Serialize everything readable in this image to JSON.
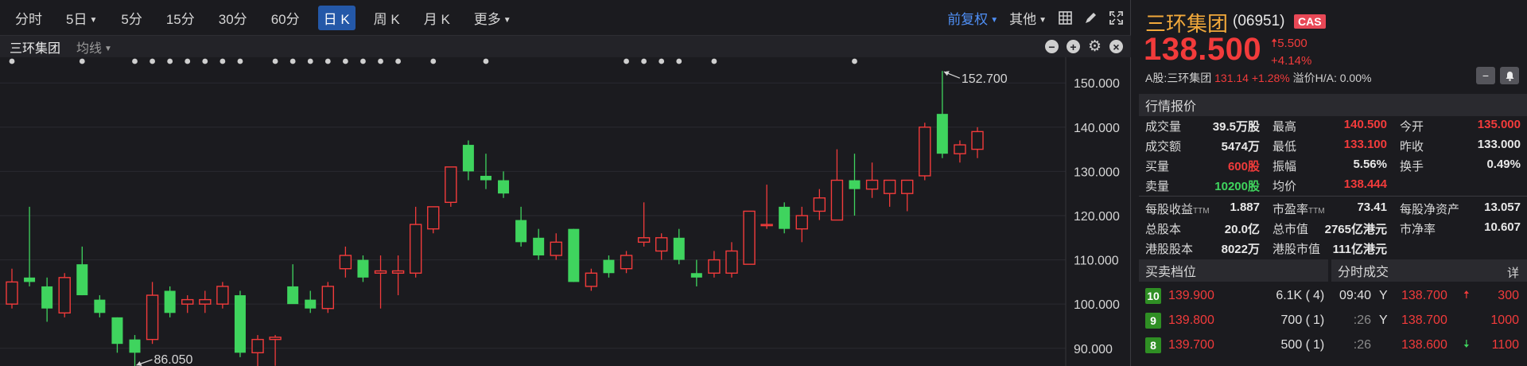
{
  "toolbar": {
    "periods": [
      "分时",
      "5日",
      "5分",
      "15分",
      "30分",
      "60分",
      "日 K",
      "周 K",
      "月 K",
      "更多"
    ],
    "fuquan": "前复权",
    "other": "其他"
  },
  "subbar": {
    "name": "三环集团",
    "ma": "均线"
  },
  "chart_data": {
    "type": "candlestick",
    "yticks": [
      "150.000",
      "140.000",
      "130.000",
      "120.000",
      "110.000",
      "100.000",
      "90.000"
    ],
    "high_label": "152.700",
    "low_label": "86.050",
    "up_color": "#f23b3b",
    "down_color": "#3fd45e",
    "markers_x_index": [
      0,
      4,
      7,
      8,
      9,
      10,
      11,
      12,
      13,
      15,
      16,
      17,
      18,
      19,
      20,
      21,
      22,
      24,
      27,
      35,
      36,
      37,
      38,
      40,
      48
    ],
    "candles": [
      {
        "o": 100,
        "h": 108,
        "l": 99,
        "c": 105
      },
      {
        "o": 106,
        "h": 122,
        "l": 104,
        "c": 105
      },
      {
        "o": 104,
        "h": 106,
        "l": 96,
        "c": 99
      },
      {
        "o": 98,
        "h": 107,
        "l": 97,
        "c": 106
      },
      {
        "o": 109,
        "h": 113,
        "l": 102,
        "c": 102
      },
      {
        "o": 101,
        "h": 102,
        "l": 97,
        "c": 98
      },
      {
        "o": 97,
        "h": 97,
        "l": 89,
        "c": 91
      },
      {
        "o": 92,
        "h": 93,
        "l": 86,
        "c": 89
      },
      {
        "o": 92,
        "h": 105,
        "l": 91,
        "c": 102
      },
      {
        "o": 103,
        "h": 104,
        "l": 97,
        "c": 98
      },
      {
        "o": 100,
        "h": 102,
        "l": 98,
        "c": 101
      },
      {
        "o": 100,
        "h": 103,
        "l": 98,
        "c": 101
      },
      {
        "o": 100,
        "h": 105,
        "l": 99,
        "c": 104
      },
      {
        "o": 102,
        "h": 103,
        "l": 88,
        "c": 89
      },
      {
        "o": 89,
        "h": 93,
        "l": 86,
        "c": 92
      },
      {
        "o": 92,
        "h": 93,
        "l": 86.05,
        "c": 92.5
      },
      {
        "o": 104,
        "h": 109,
        "l": 101,
        "c": 100
      },
      {
        "o": 101,
        "h": 103,
        "l": 98,
        "c": 99
      },
      {
        "o": 99,
        "h": 105,
        "l": 98,
        "c": 104
      },
      {
        "o": 108,
        "h": 113,
        "l": 106,
        "c": 111
      },
      {
        "o": 110,
        "h": 111,
        "l": 105,
        "c": 106
      },
      {
        "o": 107,
        "h": 111,
        "l": 99,
        "c": 107.5
      },
      {
        "o": 107,
        "h": 111,
        "l": 102,
        "c": 107.5
      },
      {
        "o": 107,
        "h": 122,
        "l": 106,
        "c": 118
      },
      {
        "o": 117,
        "h": 121,
        "l": 116,
        "c": 122
      },
      {
        "o": 123,
        "h": 128,
        "l": 122,
        "c": 131
      },
      {
        "o": 136,
        "h": 137,
        "l": 128,
        "c": 130
      },
      {
        "o": 129,
        "h": 134,
        "l": 126,
        "c": 128
      },
      {
        "o": 128,
        "h": 130,
        "l": 124,
        "c": 125
      },
      {
        "o": 119,
        "h": 122,
        "l": 113,
        "c": 114
      },
      {
        "o": 115,
        "h": 117,
        "l": 110,
        "c": 111
      },
      {
        "o": 111,
        "h": 116,
        "l": 110,
        "c": 114
      },
      {
        "o": 117,
        "h": 117,
        "l": 105,
        "c": 105
      },
      {
        "o": 104,
        "h": 108,
        "l": 103,
        "c": 107
      },
      {
        "o": 110,
        "h": 111,
        "l": 106,
        "c": 107
      },
      {
        "o": 108,
        "h": 112,
        "l": 107,
        "c": 111
      },
      {
        "o": 114,
        "h": 123,
        "l": 113,
        "c": 115
      },
      {
        "o": 112,
        "h": 116,
        "l": 110,
        "c": 115
      },
      {
        "o": 115,
        "h": 117,
        "l": 109,
        "c": 110
      },
      {
        "o": 107,
        "h": 110,
        "l": 104,
        "c": 106
      },
      {
        "o": 107,
        "h": 112,
        "l": 106,
        "c": 110
      },
      {
        "o": 107,
        "h": 114,
        "l": 106,
        "c": 112
      },
      {
        "o": 109,
        "h": 121,
        "l": 109,
        "c": 121
      },
      {
        "o": 118,
        "h": 127,
        "l": 117,
        "c": 118
      },
      {
        "o": 122,
        "h": 123,
        "l": 116,
        "c": 117
      },
      {
        "o": 117,
        "h": 122,
        "l": 114,
        "c": 120
      },
      {
        "o": 121,
        "h": 126,
        "l": 119,
        "c": 124
      },
      {
        "o": 119,
        "h": 135,
        "l": 119,
        "c": 128
      },
      {
        "o": 128,
        "h": 134,
        "l": 120,
        "c": 126
      },
      {
        "o": 126,
        "h": 132,
        "l": 124,
        "c": 128
      },
      {
        "o": 125,
        "h": 128,
        "l": 122,
        "c": 128
      },
      {
        "o": 125,
        "h": 127,
        "l": 121,
        "c": 128
      },
      {
        "o": 129,
        "h": 141,
        "l": 128,
        "c": 140
      },
      {
        "o": 143,
        "h": 152.7,
        "l": 133,
        "c": 134
      },
      {
        "o": 134,
        "h": 137,
        "l": 132,
        "c": 136
      },
      {
        "o": 135,
        "h": 140,
        "l": 133,
        "c": 139
      }
    ]
  },
  "header": {
    "name": "三环集团",
    "code": "(06951)",
    "badge": "CAS",
    "price": "138.500",
    "change": "5.500",
    "pct": "+4.14%",
    "a_label": "A股:三环集团",
    "a_price": "131.14",
    "a_pct": "+1.28%",
    "premium": "溢价H/A: 0.00%"
  },
  "quote": {
    "title": "行情报价",
    "rows": [
      [
        {
          "l": "成交量",
          "v": "39.5万股",
          "c": ""
        },
        {
          "l": "最高",
          "v": "140.500",
          "c": "red"
        },
        {
          "l": "今开",
          "v": "135.000",
          "c": "red"
        }
      ],
      [
        {
          "l": "成交额",
          "v": "5474万",
          "c": ""
        },
        {
          "l": "最低",
          "v": "133.100",
          "c": "red"
        },
        {
          "l": "昨收",
          "v": "133.000",
          "c": ""
        }
      ],
      [
        {
          "l": "买量",
          "v": "600股",
          "c": "red"
        },
        {
          "l": "振幅",
          "v": "5.56%",
          "c": ""
        },
        {
          "l": "换手",
          "v": "0.49%",
          "c": ""
        }
      ],
      [
        {
          "l": "卖量",
          "v": "10200股",
          "c": "green"
        },
        {
          "l": "均价",
          "v": "138.444",
          "c": "red"
        },
        {
          "l": "",
          "v": "",
          "c": ""
        }
      ]
    ],
    "rows2": [
      [
        {
          "l": "每股收益",
          "ttm": "TTM",
          "v": "1.887"
        },
        {
          "l": "市盈率",
          "ttm": "TTM",
          "v": "73.41"
        },
        {
          "l": "每股净资产",
          "ttm": "",
          "v": "13.057"
        }
      ],
      [
        {
          "l": "总股本",
          "ttm": "",
          "v": "20.0亿"
        },
        {
          "l": "总市值",
          "ttm": "",
          "v": "2765亿港元"
        },
        {
          "l": "市净率",
          "ttm": "",
          "v": "10.607"
        }
      ],
      [
        {
          "l": "港股股本",
          "ttm": "",
          "v": "8022万"
        },
        {
          "l": "港股市值",
          "ttm": "",
          "v": "111亿港元"
        },
        {
          "l": "",
          "ttm": "",
          "v": ""
        }
      ]
    ]
  },
  "orderbook": {
    "title": "买卖档位",
    "rows": [
      {
        "level": "10",
        "price": "139.900",
        "vol": "6.1K (",
        "n": "4)"
      },
      {
        "level": "9",
        "price": "139.800",
        "vol": "700 (",
        "n": "1)"
      },
      {
        "level": "8",
        "price": "139.700",
        "vol": "500 (",
        "n": "1)"
      }
    ]
  },
  "ticks": {
    "title": "分时成交",
    "detail": "详",
    "rows": [
      {
        "t": "09:40",
        "f": "Y",
        "p": "138.700",
        "dir": "up",
        "v": "300"
      },
      {
        "t": ":26",
        "f": "Y",
        "p": "138.700",
        "dir": "",
        "v": "1000"
      },
      {
        "t": ":26",
        "f": "",
        "p": "138.600",
        "dir": "down",
        "v": "1100"
      }
    ]
  }
}
